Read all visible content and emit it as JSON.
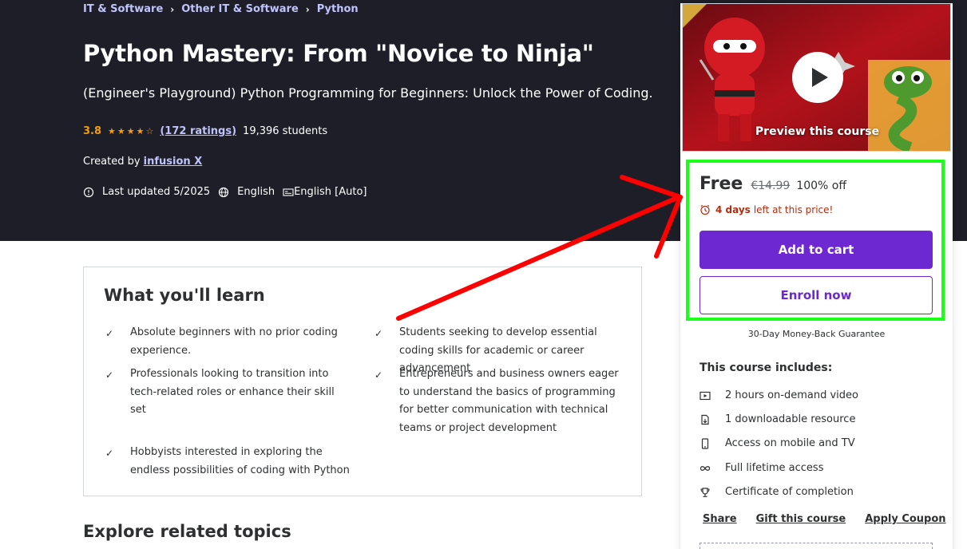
{
  "breadcrumb": [
    {
      "label": "IT & Software"
    },
    {
      "label": "Other IT & Software"
    },
    {
      "label": "Python"
    }
  ],
  "course": {
    "title": "Python Mastery: From \"Novice to Ninja\"",
    "subtitle": "(Engineer's Playground) Python Programming for Beginners: Unlock the Power of Coding.",
    "rating": "3.8",
    "rating_value": 3.8,
    "ratings_count": "(172 ratings)",
    "students": "19,396 students",
    "created_by_label": "Created by",
    "author": "infusion X",
    "last_updated": "Last updated 5/2025",
    "language": "English",
    "captions": "English [Auto]"
  },
  "learn": {
    "title": "What you'll learn",
    "items": [
      {
        "text": "Absolute beginners with no prior coding experience."
      },
      {
        "text": "Students seeking to develop essential coding skills for academic or career advancement"
      },
      {
        "text": "Professionals looking to transition into tech-related roles or enhance their skill set"
      },
      {
        "text": "Entrepreneurs and business owners eager to understand the basics of programming for better communication with technical teams or project development"
      },
      {
        "text": "Hobbyists interested in exploring the endless possibilities of coding with Python"
      }
    ]
  },
  "explore": {
    "title": "Explore related topics"
  },
  "sidebar": {
    "preview_label": "Preview this course",
    "price": "Free",
    "original_price": "€14.99",
    "discount": "100% off",
    "urgency_bold": "4 days",
    "urgency_rest": "left at this price!",
    "add_to_cart": "Add to cart",
    "enroll_now": "Enroll now",
    "guarantee": "30-Day Money-Back Guarantee",
    "includes_title": "This course includes:",
    "includes": [
      {
        "icon": "video-icon",
        "text": "2 hours on-demand video"
      },
      {
        "icon": "file-download-icon",
        "text": "1 downloadable resource"
      },
      {
        "icon": "mobile-icon",
        "text": "Access on mobile and TV"
      },
      {
        "icon": "infinity-icon",
        "text": "Full lifetime access"
      },
      {
        "icon": "trophy-icon",
        "text": "Certificate of completion"
      }
    ],
    "links": {
      "share": "Share",
      "gift": "Gift this course",
      "coupon": "Apply Coupon"
    }
  },
  "colors": {
    "hero_bg": "#1d1e27",
    "accent_purple": "#6d28d2",
    "link_lavender": "#c0c4fc",
    "star_orange": "#f69c08",
    "urgency_red": "#b32d0f",
    "highlight_green": "#1bff1b",
    "annotation_arrow": "#ff0000"
  }
}
